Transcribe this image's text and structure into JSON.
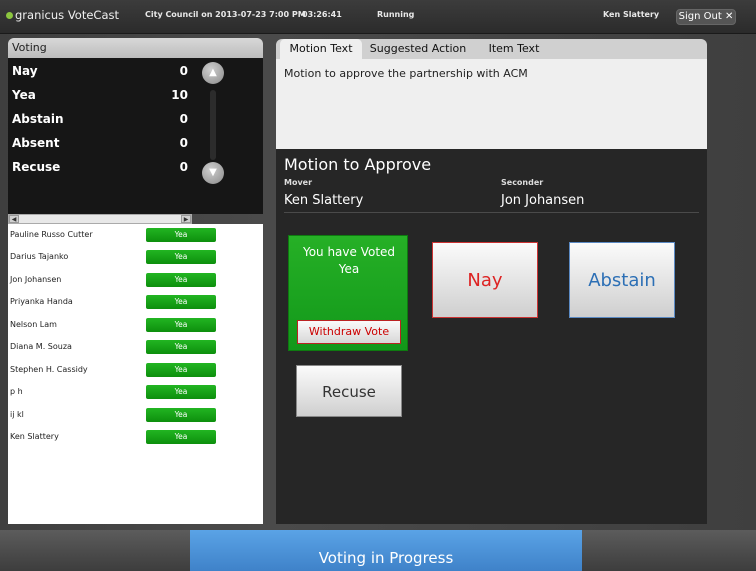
{
  "topbar": {
    "brand": "granicus",
    "product": "VoteCast",
    "meeting": "City Council on 2013-07-23 7:00 PM",
    "timer": "03:26:41",
    "state": "Running",
    "user": "Ken Slattery",
    "signout_label": "Sign Out ✕"
  },
  "voting": {
    "title": "Voting",
    "tallies": [
      {
        "label": "Nay",
        "count": "0"
      },
      {
        "label": "Yea",
        "count": "10"
      },
      {
        "label": "Abstain",
        "count": "0"
      },
      {
        "label": "Absent",
        "count": "0"
      },
      {
        "label": "Recuse",
        "count": "0"
      }
    ],
    "members": [
      {
        "name": "Pauline Russo Cutter",
        "vote": "Yea"
      },
      {
        "name": "Darius Tajanko",
        "vote": "Yea"
      },
      {
        "name": "Jon Johansen",
        "vote": "Yea"
      },
      {
        "name": "Priyanka Handa",
        "vote": "Yea"
      },
      {
        "name": "Nelson Lam",
        "vote": "Yea"
      },
      {
        "name": "Diana M. Souza",
        "vote": "Yea"
      },
      {
        "name": "Stephen H. Cassidy",
        "vote": "Yea"
      },
      {
        "name": "p h",
        "vote": "Yea"
      },
      {
        "name": "ij kl",
        "vote": "Yea"
      },
      {
        "name": "Ken Slattery",
        "vote": "Yea"
      }
    ]
  },
  "tabs": [
    "Motion Text",
    "Suggested Action",
    "Item Text"
  ],
  "motion": {
    "text": "Motion to approve the partnership with ACM",
    "title": "Motion to Approve",
    "mover_label": "Mover",
    "mover": "Ken Slattery",
    "seconder_label": "Seconder",
    "seconder": "Jon Johansen"
  },
  "vote_panel": {
    "voted_line1": "You have Voted",
    "voted_line2": "Yea",
    "withdraw_label": "Withdraw Vote",
    "nay_label": "Nay",
    "abstain_label": "Abstain",
    "recuse_label": "Recuse"
  },
  "footer": {
    "status": "Voting in Progress"
  },
  "colors": {
    "yea_green": "#12981a",
    "nay_red": "#d22222",
    "abstain_blue": "#2c6fb5",
    "status_blue": "#4a90d9"
  }
}
